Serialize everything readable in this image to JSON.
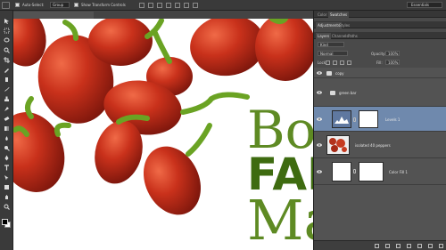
{
  "options_bar": {
    "auto_select_label": "Auto-Select:",
    "auto_select_value": "Group",
    "show_transform_label": "Show Transform Controls",
    "workspace": "Essentials"
  },
  "tools": [
    "move-tool-icon",
    "marquee-tool-icon",
    "lasso-tool-icon",
    "quick-select-tool-icon",
    "crop-tool-icon",
    "eyedropper-tool-icon",
    "healing-brush-tool-icon",
    "brush-tool-icon",
    "clone-stamp-tool-icon",
    "history-brush-tool-icon",
    "eraser-tool-icon",
    "gradient-tool-icon",
    "blur-tool-icon",
    "dodge-tool-icon",
    "pen-tool-icon",
    "type-tool-icon",
    "path-select-tool-icon",
    "shape-tool-icon",
    "hand-tool-icon",
    "zoom-tool-icon"
  ],
  "canvas": {
    "word1": "Bo",
    "word2": "FAR",
    "word3": "Ma",
    "text_color": "#5e8a23"
  },
  "panels": {
    "top_tabs": [
      "Color",
      "Swatches"
    ],
    "second_tabs": [
      "Adjustments",
      "Styles"
    ],
    "layer_tabs": [
      "Layers",
      "Channels",
      "Paths"
    ],
    "kind_label": "Kind",
    "blend_mode": "Normal",
    "opacity_label": "Opacity:",
    "opacity_value": "100%",
    "lock_label": "Lock:",
    "fill_label": "Fill:",
    "fill_value": "100%"
  },
  "layers": [
    {
      "name": "copy",
      "kind": "group",
      "selected": false
    },
    {
      "name": "green bar",
      "kind": "group",
      "selected": false
    },
    {
      "name": "Levels 1",
      "kind": "adjustment",
      "selected": true
    },
    {
      "name": "isolated 40 peppers",
      "kind": "image",
      "selected": false
    },
    {
      "name": "Color Fill 1",
      "kind": "fill",
      "selected": false
    }
  ],
  "accent_colors": {
    "selection": "#6f89ad",
    "pepper_red": "#c9311b",
    "stem_green": "#6aa323"
  }
}
